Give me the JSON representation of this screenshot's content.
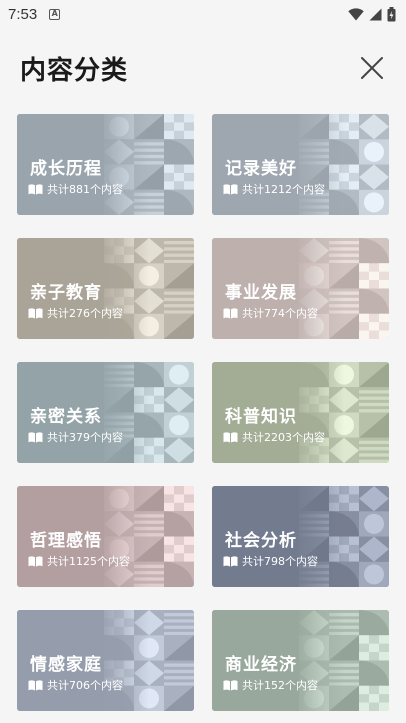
{
  "status_bar": {
    "time": "7:53",
    "notif_glyph": "A"
  },
  "header": {
    "title": "内容分类",
    "close_icon": "close-icon"
  },
  "categories": [
    {
      "title": "成长历程",
      "count_text": "共计881个内容",
      "color": "#9aa4ad"
    },
    {
      "title": "记录美好",
      "count_text": "共计1212个内容",
      "color": "#9ea7af"
    },
    {
      "title": "亲子教育",
      "count_text": "共计276个内容",
      "color": "#a9a497"
    },
    {
      "title": "事业发展",
      "count_text": "共计774个内容",
      "color": "#bdb0ad"
    },
    {
      "title": "亲密关系",
      "count_text": "共计379个内容",
      "color": "#93a3a7"
    },
    {
      "title": "科普知识",
      "count_text": "共计2203个内容",
      "color": "#a3ad96"
    },
    {
      "title": "哲理感悟",
      "count_text": "共计1125个内容",
      "color": "#b39ea0"
    },
    {
      "title": "社会分析",
      "count_text": "共计798个内容",
      "color": "#737b8f"
    },
    {
      "title": "情感家庭",
      "count_text": "共计706个内容",
      "color": "#959dac"
    },
    {
      "title": "商业经济",
      "count_text": "共计152个内容",
      "color": "#98a89c"
    }
  ]
}
